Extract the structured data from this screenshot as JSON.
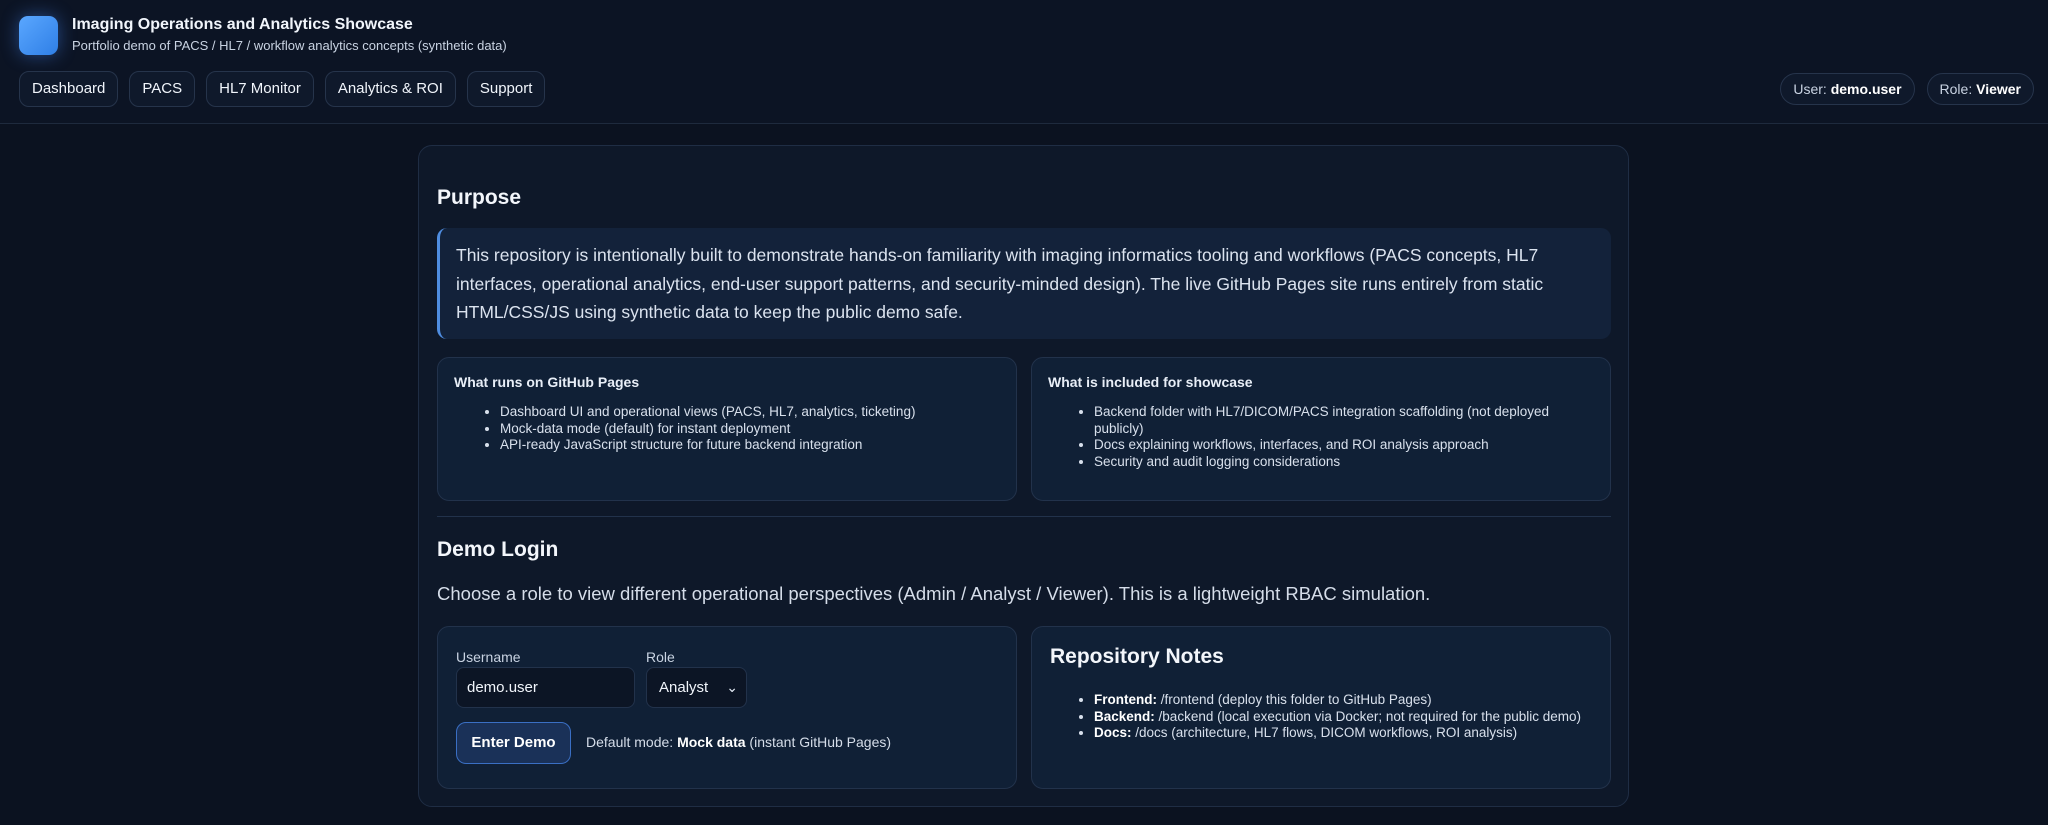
{
  "header": {
    "title": "Imaging Operations and Analytics Showcase",
    "subtitle": "Portfolio demo of PACS / HL7 / workflow analytics concepts (synthetic data)",
    "nav": [
      "Dashboard",
      "PACS",
      "HL7 Monitor",
      "Analytics & ROI",
      "Support"
    ],
    "user_label": "User:",
    "user_value": "demo.user",
    "role_label": "Role:",
    "role_value": "Viewer"
  },
  "purpose": {
    "heading": "Purpose",
    "text": "This repository is intentionally built to demonstrate hands-on familiarity with imaging informatics tooling and workflows (PACS concepts, HL7 interfaces, operational analytics, end-user support patterns, and security-minded design). The live GitHub Pages site runs entirely from static HTML/CSS/JS using synthetic data to keep the public demo safe.",
    "runs": {
      "title": "What runs on GitHub Pages",
      "items": [
        "Dashboard UI and operational views (PACS, HL7, analytics, ticketing)",
        "Mock-data mode (default) for instant deployment",
        "API-ready JavaScript structure for future backend integration"
      ]
    },
    "included": {
      "title": "What is included for showcase",
      "items": [
        "Backend folder with HL7/DICOM/PACS integration scaffolding (not deployed publicly)",
        "Docs explaining workflows, interfaces, and ROI analysis approach",
        "Security and audit logging considerations"
      ]
    }
  },
  "login": {
    "heading": "Demo Login",
    "text": "Choose a role to view different operational perspectives (Admin / Analyst / Viewer). This is a lightweight RBAC simulation.",
    "username_label": "Username",
    "username_value": "demo.user",
    "role_label": "Role",
    "role_selected": "Analyst",
    "enter_button": "Enter Demo",
    "mode_prefix": "Default mode:",
    "mode_value": "Mock data",
    "mode_suffix": "(instant GitHub Pages)"
  },
  "notes": {
    "title": "Repository Notes",
    "items": [
      {
        "key": "Frontend:",
        "value": "/frontend (deploy this folder to GitHub Pages)"
      },
      {
        "key": "Backend:",
        "value": "/backend (local execution via Docker; not required for the public demo)"
      },
      {
        "key": "Docs:",
        "value": "/docs (architecture, HL7 flows, DICOM workflows, ROI analysis)"
      }
    ]
  },
  "colors": {
    "background": "#0b1220",
    "card": "#0e1829",
    "accent": "#4f8de0",
    "logo": "#3b8df5"
  }
}
